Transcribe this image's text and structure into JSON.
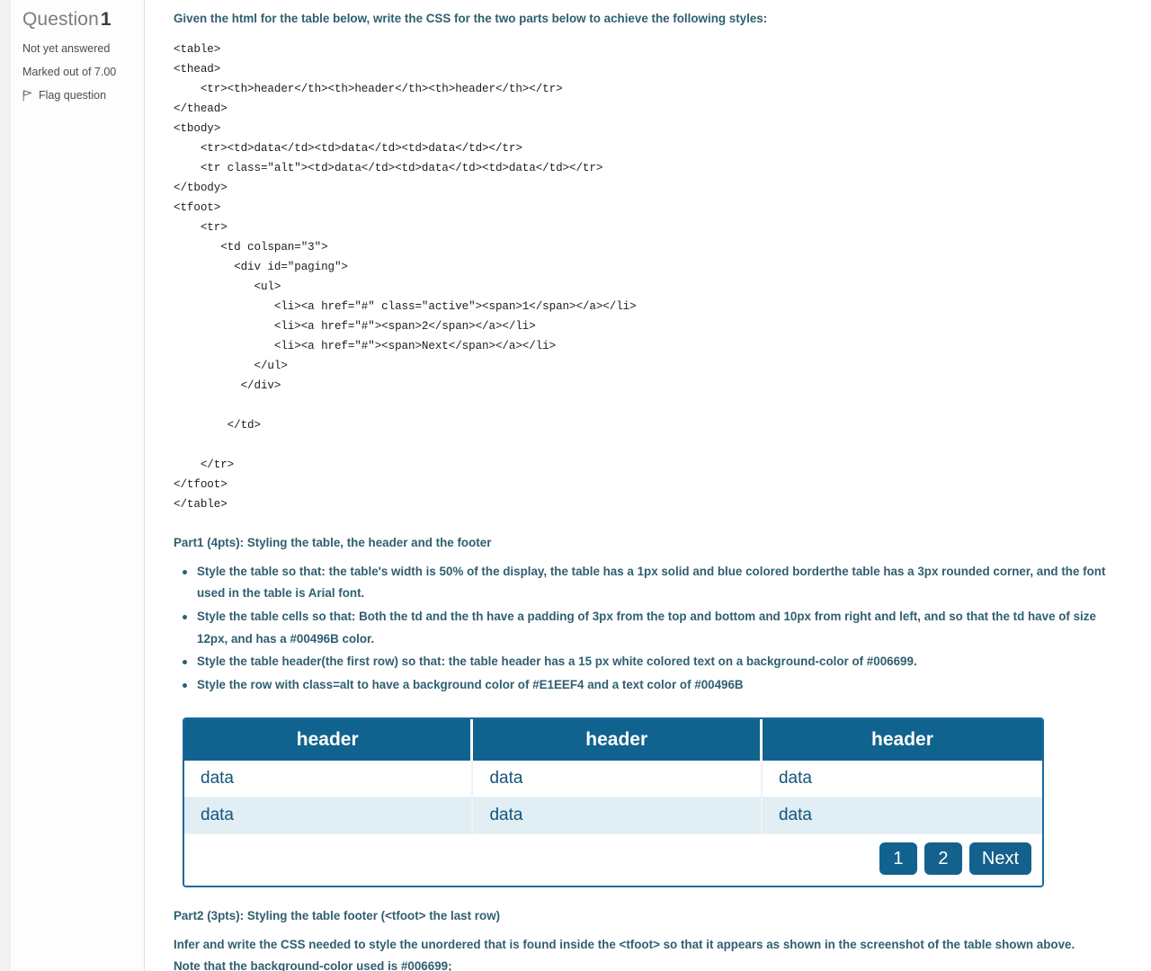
{
  "question_info": {
    "title_label": "Question",
    "number": "1",
    "status": "Not yet answered",
    "marks": "Marked out of 7.00",
    "flag_label": "Flag question",
    "flag_icon": "flag-icon"
  },
  "content": {
    "lead": "Given the html for the table below, write the CSS for the two parts below to achieve the following styles:",
    "code": "<table>\n<thead>\n    <tr><th>header</th><th>header</th><th>header</th></tr>\n</thead>\n<tbody>\n    <tr><td>data</td><td>data</td><td>data</td></tr>\n    <tr class=\"alt\"><td>data</td><td>data</td><td>data</td></tr>\n</tbody>\n<tfoot>\n    <tr>\n       <td colspan=\"3\">\n         <div id=\"paging\">\n            <ul>\n               <li><a href=\"#\" class=\"active\"><span>1</span></a></li>\n               <li><a href=\"#\"><span>2</span></a></li>\n               <li><a href=\"#\"><span>Next</span></a></li>\n            </ul>\n          </div>\n\n        </td>\n\n    </tr>\n</tfoot>\n</table>",
    "part1_title": "Part1 (4pts):  Styling the table, the header and the footer",
    "part1_requirements": [
      "Style the table so that:  the table's width is 50% of the display, the table has a 1px solid and blue colored borderthe table has a 3px rounded corner, and the font used in the table is Arial font.",
      "Style the table cells so that: Both the td and the th have a padding of 3px from the top and bottom and 10px from right and left, and so that the td have of size 12px, and has a #00496B color.",
      "Style the table header(the first row) so that: the table header has a 15 px  white colored text on a background-color of #006699.",
      "Style the row with class=alt to have a  background color of #E1EEF4 and a text color of #00496B"
    ],
    "part2_title": "Part2 (3pts):  Styling the table footer (<tfoot> the last row)",
    "part2_text": "Infer and write the CSS needed to style the unordered that is found inside the <tfoot> so that it appears as shown in the screenshot of the table shown above. Note that the background-color used is #006699;"
  },
  "sample_table": {
    "headers": [
      "header",
      "header",
      "header"
    ],
    "rows": [
      {
        "class": "",
        "cells": [
          "data",
          "data",
          "data"
        ]
      },
      {
        "class": "alt",
        "cells": [
          "data",
          "data",
          "data"
        ]
      }
    ],
    "paging": [
      {
        "label": "1",
        "active": true
      },
      {
        "label": "2",
        "active": false
      },
      {
        "label": "Next",
        "active": false
      }
    ]
  },
  "colors": {
    "heading_text": "#2f5f70",
    "table_header_bg": "#006699",
    "table_alt_bg": "#E1EEF4",
    "table_text": "#00496B"
  }
}
